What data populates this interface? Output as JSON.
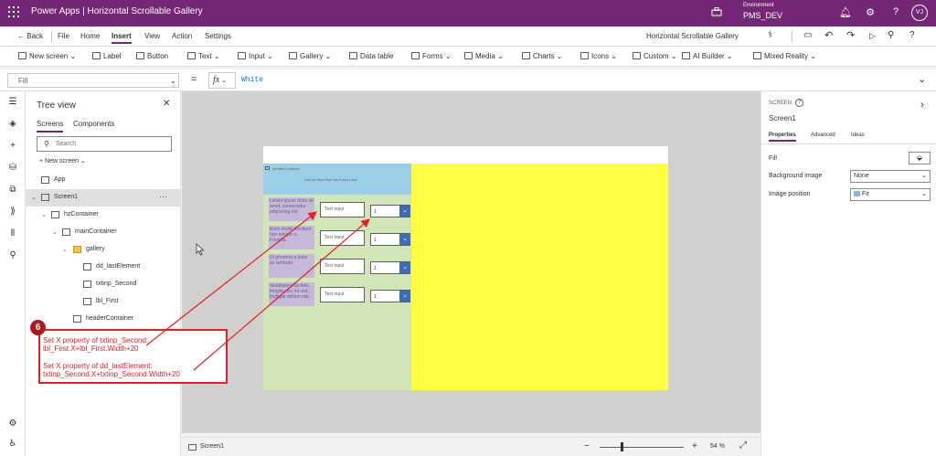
{
  "titlebar": {
    "app_title": "Power Apps  |  Horizontal Scrollable Gallery",
    "environment_label": "Environment",
    "environment_name": "PMS_DEV",
    "avatar_initials": "VJ",
    "icons": [
      "waffle-icon",
      "environment-icon",
      "bell-icon",
      "gear-icon",
      "help-icon"
    ]
  },
  "menubar": {
    "back": "Back",
    "items": [
      "File",
      "Home",
      "Insert",
      "View",
      "Action",
      "Settings"
    ],
    "active": "Insert",
    "app_name": "Horizontal Scrollable Gallery"
  },
  "ribbon": {
    "items": [
      "New screen",
      "Label",
      "Button",
      "Text",
      "Input",
      "Gallery",
      "Data table",
      "Forms",
      "Media",
      "Charts",
      "Icons",
      "Custom",
      "AI Builder",
      "Mixed Reality"
    ]
  },
  "formula": {
    "property": "Fill",
    "fx": "fx",
    "value": "White"
  },
  "treeview": {
    "title": "Tree view",
    "tabs": [
      "Screens",
      "Components"
    ],
    "search_placeholder": "Search",
    "new_screen": "New screen",
    "nodes": [
      "App",
      "Screen1",
      "hzContainer",
      "mainContainer",
      "gallery",
      "dd_lastElement",
      "txtinp_Second",
      "lbl_First",
      "headerContainer"
    ]
  },
  "canvas": {
    "header_label": "headerContainer",
    "header_message": "Add an item from the Insert pane",
    "rows": [
      {
        "label": "Lorem ipsum dolor sit amet, consectetur adipiscing elit.",
        "input": "Text input",
        "dropdown": "1"
      },
      {
        "label": "Enim morbi tincidunt non integer a. Fringilla.",
        "input": "Text input",
        "dropdown": "1"
      },
      {
        "label": "Ut pharetra a dolor ac vehicula.",
        "input": "Text input",
        "dropdown": "1"
      },
      {
        "label": "Vestibulum dui felis, fringilla nec mi sed, tristique dictum nisi.",
        "input": "Text input",
        "dropdown": "1"
      }
    ]
  },
  "annotation": {
    "number": "6",
    "line1": "Set X property of txtinp_Second: lbl_First.X+lbl_First.Width+20",
    "line2": "Set X property of dd_lastElement: txtinp_Second.X+txtinp_Second.Width+20",
    "color": "#e0202a"
  },
  "statusbar": {
    "screen": "Screen1",
    "zoom_minus": "−",
    "zoom_plus": "+",
    "zoom_percent": "54 %"
  },
  "properties": {
    "type": "SCREEN",
    "name": "Screen1",
    "tabs": [
      "Properties",
      "Advanced",
      "Ideas"
    ],
    "fill_label": "Fill",
    "background_image_label": "Background image",
    "background_image_value": "None",
    "image_position_label": "Image position",
    "image_position_value": "Fit"
  },
  "colors": {
    "brand": "#742774",
    "main_container": "#d1e6b6",
    "header_container": "#9bcfe8",
    "yellow_area": "#ffff44",
    "label_fill": "#c5b8d8"
  }
}
